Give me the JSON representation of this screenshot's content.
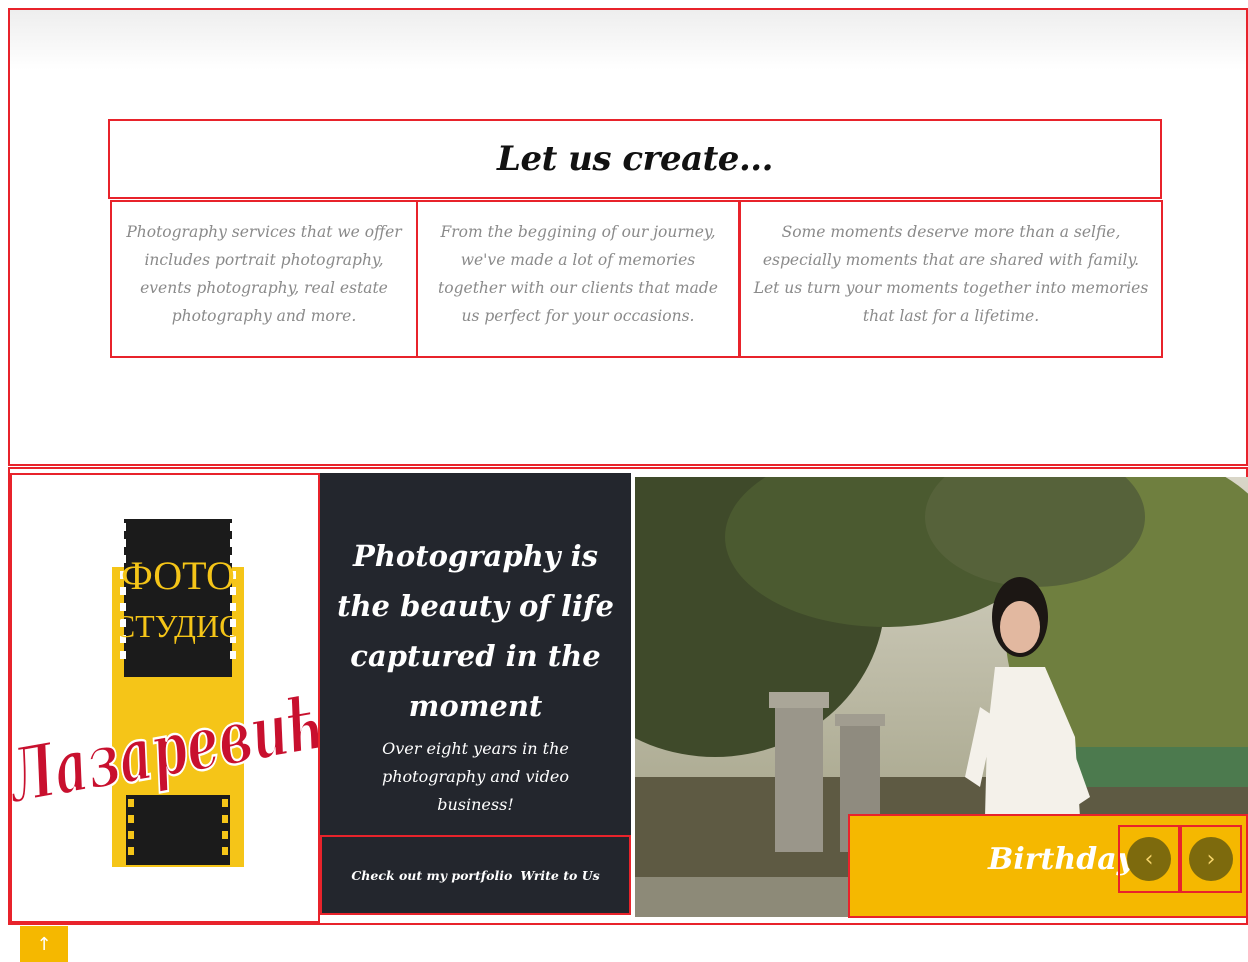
{
  "intro": {
    "title": "Let us create...",
    "cards": [
      {
        "text": "Photography services that we offer includes portrait photography, events photography, real estate photography and more."
      },
      {
        "text": "From the beggining of our journey, we've made a lot of memories together with our clients that made us perfect for your occasions."
      },
      {
        "text": "Some moments deserve more than a selfie, especially moments that are shared with family. Let us turn your moments together into memories that last for a lifetime."
      }
    ]
  },
  "banner": {
    "logo": {
      "top_text": "ФОТО",
      "middle_text": "СТУДИО",
      "script_text": "Лазаревић",
      "colors": {
        "yellow": "#f5c518",
        "black": "#1b1b1b",
        "crimson": "#c8102e"
      }
    },
    "heading": "Photography is the beauty of life captured in the moment",
    "subtext": "Over eight years in the photography and video business!",
    "links": {
      "portfolio": "Check out my portfolio",
      "contact": "Write to Us"
    },
    "slider": {
      "caption": "Birthdays",
      "prev_icon": "chevron-left-icon",
      "next_icon": "chevron-right-icon",
      "prev_glyph": "‹",
      "next_glyph": "›"
    }
  },
  "scroll_top": {
    "glyph": "↑",
    "icon": "arrow-up-icon"
  },
  "colors": {
    "border": "#e8232b",
    "accent": "#f5b800",
    "dark_panel": "#23262d",
    "muted_text": "#8a8a8a"
  }
}
